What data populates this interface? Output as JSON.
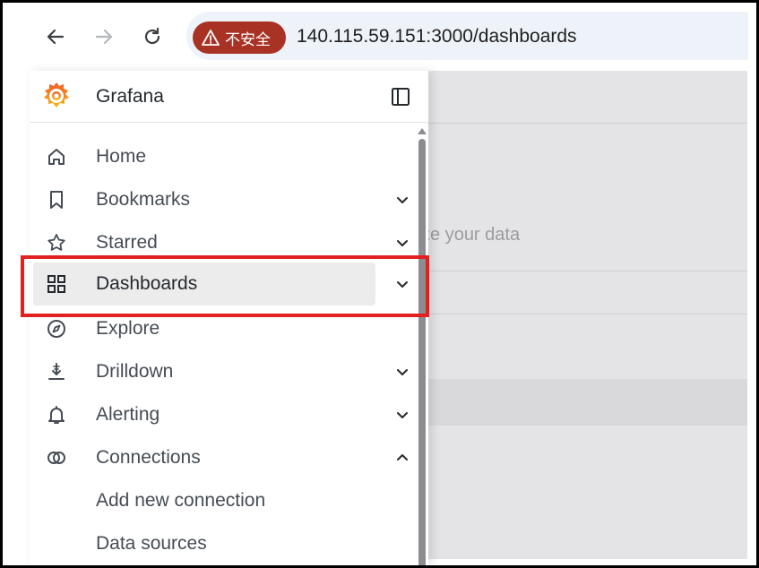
{
  "browser": {
    "security_label": "不安全",
    "url": "140.115.59.151:3000/dashboards",
    "icons": [
      "back-arrow-icon",
      "forward-arrow-icon",
      "reload-icon",
      "warning-icon"
    ]
  },
  "sidebar": {
    "brand": "Grafana",
    "items": [
      {
        "label": "Home",
        "icon": "home-icon",
        "expanded": null
      },
      {
        "label": "Bookmarks",
        "icon": "bookmark-icon",
        "expanded": false
      },
      {
        "label": "Starred",
        "icon": "star-icon",
        "expanded": false
      },
      {
        "label": "Dashboards",
        "icon": "apps-grid-icon",
        "expanded": false,
        "active": true
      },
      {
        "label": "Explore",
        "icon": "compass-icon",
        "expanded": null
      },
      {
        "label": "Drilldown",
        "icon": "drilldown-icon",
        "expanded": false
      },
      {
        "label": "Alerting",
        "icon": "bell-icon",
        "expanded": false
      },
      {
        "label": "Connections",
        "icon": "connections-icon",
        "expanded": true
      }
    ],
    "subitems": [
      {
        "label": "Add new connection"
      },
      {
        "label": "Data sources"
      }
    ]
  },
  "background": {
    "partial_text": "alize your data"
  },
  "colors": {
    "accent": "#e05a2b",
    "not_secure": "#a83224",
    "highlight_box": "#e1201f"
  }
}
